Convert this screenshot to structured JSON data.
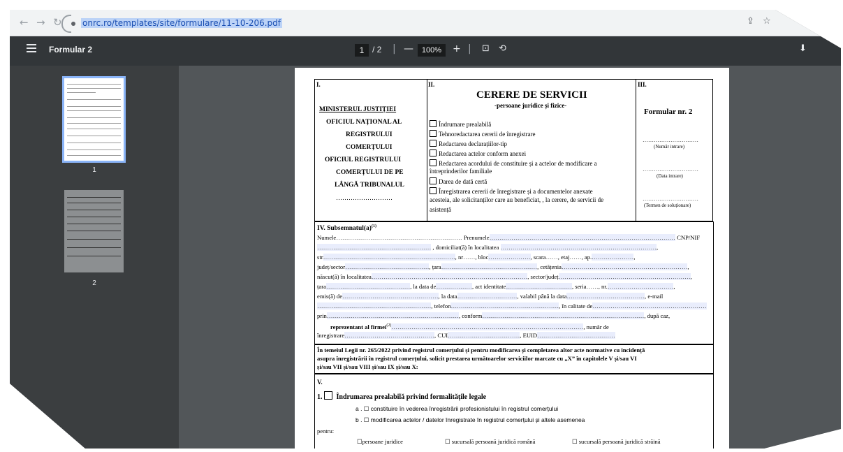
{
  "browser": {
    "url": "onrc.ro/templates/site/formulare/11-10-206.pdf",
    "back_icon": "arrow-left-icon",
    "forward_icon": "arrow-right-icon",
    "reload_icon": "reload-icon"
  },
  "viewer": {
    "title": "Formular 2",
    "current_page": "1",
    "page_separator": "/ 2",
    "zoom": "100%",
    "zoom_out": "—",
    "zoom_in": "+",
    "thumbnails": [
      "1",
      "2"
    ]
  },
  "form": {
    "sec1_num": "I.",
    "sec2_num": "II.",
    "sec3_num": "III.",
    "ministry": "MINISTERUL JUSTIȚIEI",
    "office_lines": [
      "OFICIUL NAȚIONAL AL",
      "REGISTRULUI",
      "COMERȚULUI",
      "OFICIUL REGISTRULUI",
      "COMERȚULUI DE PE",
      "LÂNGĂ TRIBUNALUL"
    ],
    "office_dots": "………………………",
    "title": "CERERE DE SERVICII",
    "subtitle": "-persoane juridice și fizice-",
    "services": [
      "Îndrumare prealabilă",
      "Tehnoredactarea cererii de înregistrare",
      "Redactarea declarațiilor-tip",
      "Redactarea actelor conform anexei",
      "Redactarea acordului de constituire și a actelor de modificare a",
      "Darea de dată certă",
      "Înregistrarea cererii de înregistrare și a documentelor anexate"
    ],
    "services_cont": [
      "întreprinderilor familiale",
      "acesteia, ale solicitanților care au beneficiat, , la cerere, de servicii de",
      "asistență"
    ],
    "form_no": "Formular nr. 2",
    "reg_fields": [
      "(Număr intrare)",
      "(Data intrare)",
      "(Termen de soluționare)"
    ],
    "sec4_title": "IV. Subsemnatul(a)",
    "sec4_sup": "(1)",
    "person_lines": [
      [
        "Numele",
        "Prenumele",
        "CNP/NIF"
      ],
      [
        "domiciliat(ă)",
        "în",
        "localitatea"
      ],
      [
        "str",
        "nr",
        "bloc",
        "scara",
        "etaj",
        "ap."
      ],
      [
        "județ/sector",
        "țara",
        "cetățenia"
      ],
      [
        "născut(ă) în localitatea",
        "sector/județ"
      ],
      [
        "țara",
        "la data de",
        "act identitate",
        "seria",
        "nr."
      ],
      [
        "emis(ă) de",
        "la data",
        "valabil până la data",
        "e-mail"
      ],
      [
        "telefon",
        "în",
        "calitate",
        "de"
      ],
      [
        "prin",
        "conform",
        "după caz,"
      ],
      [
        "reprezentant al firmei",
        "număr de"
      ],
      [
        "înregistrare",
        "CUI",
        "EUID"
      ]
    ],
    "rep_sup": "(2)",
    "legal_text": [
      "În temeiul Legii nr. 265/2022 privind registrul comerțului și pentru modificarea și completarea altor acte normative cu incidență",
      "asupra înregistrării în registrul comerțului, solicit prestarea următoarelor serviciilor marcate cu „X” în capitolele V și/sau VI",
      "și/sau VII și/sau VIII și/sau IX și/sau X:"
    ],
    "sec5_num": "V.",
    "item1_num": "1.",
    "item1": "Îndrumarea prealabilă privind formalitățile legale",
    "item1a": "a . ☐ constituire în vederea înregistrării profesionistului în registrul comerțului",
    "item1b": "b . ☐ modificarea actelor / datelor înregistrate în registrul comerțului și altele asemenea",
    "for_label": "pentru:",
    "entity_types": [
      "☐persoane juridice",
      "☐ sucursală persoană juridică română",
      "☐ sucursală persoană juridică străină"
    ]
  }
}
